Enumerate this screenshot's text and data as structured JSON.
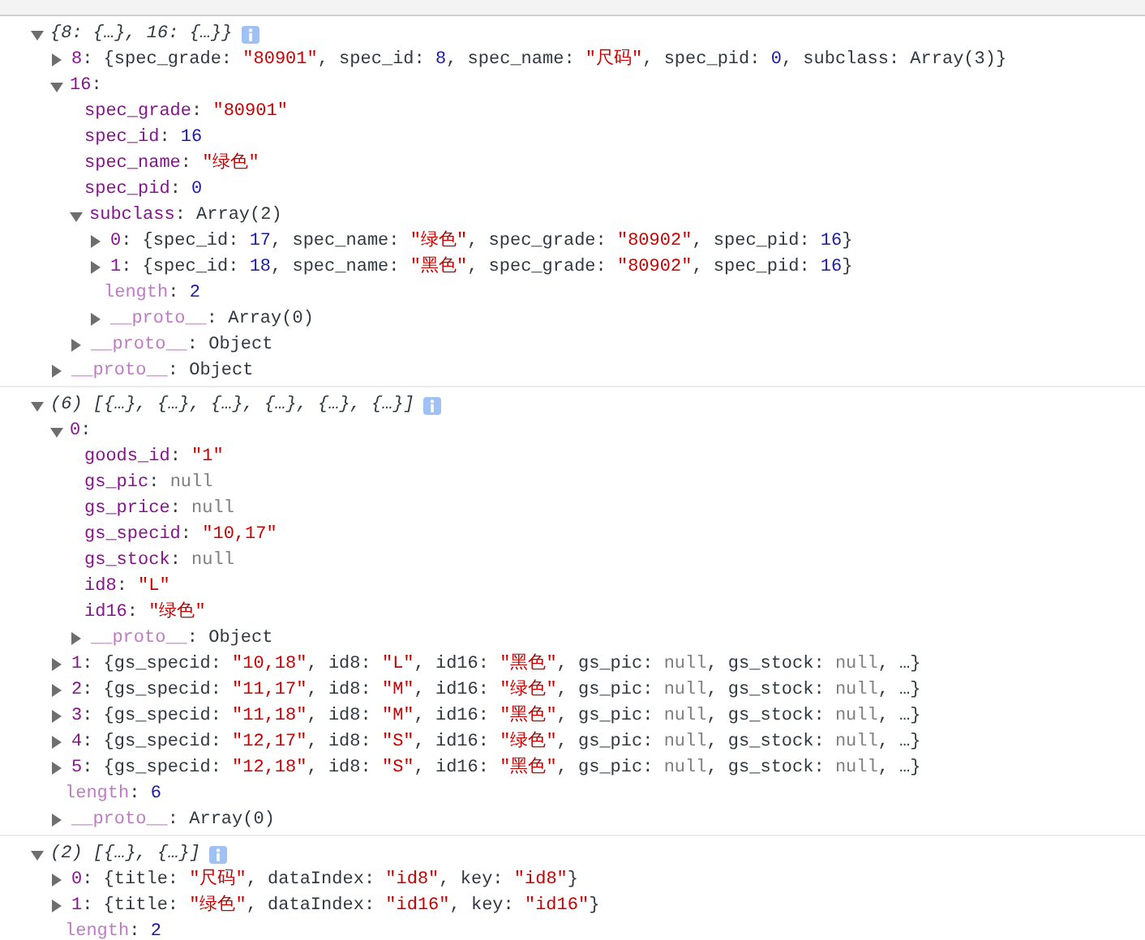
{
  "messages": [
    {
      "summary": [
        {
          "kind": "summary",
          "text": "{8: {…}, 16: {…}}"
        }
      ],
      "info_icon": true,
      "expanded": true,
      "children": [
        {
          "text": [
            {
              "kind": "index",
              "text": "8"
            },
            {
              "kind": "plain",
              "text": ": {spec_grade: "
            },
            {
              "kind": "str",
              "text": "\"80901\""
            },
            {
              "kind": "plain",
              "text": ", spec_id: "
            },
            {
              "kind": "num",
              "text": "8"
            },
            {
              "kind": "plain",
              "text": ", spec_name: "
            },
            {
              "kind": "str",
              "text": "\"尺码\""
            },
            {
              "kind": "plain",
              "text": ", spec_pid: "
            },
            {
              "kind": "num",
              "text": "0"
            },
            {
              "kind": "plain",
              "text": ", subclass: Array(3)}"
            }
          ],
          "expanded": false
        },
        {
          "text": [
            {
              "kind": "index",
              "text": "16"
            },
            {
              "kind": "plain",
              "text": ":"
            }
          ],
          "expanded": true,
          "children": [
            {
              "text": [
                {
                  "kind": "key",
                  "text": "spec_grade"
                },
                {
                  "kind": "plain",
                  "text": ": "
                },
                {
                  "kind": "str",
                  "text": "\"80901\""
                }
              ]
            },
            {
              "text": [
                {
                  "kind": "key",
                  "text": "spec_id"
                },
                {
                  "kind": "plain",
                  "text": ": "
                },
                {
                  "kind": "num",
                  "text": "16"
                }
              ]
            },
            {
              "text": [
                {
                  "kind": "key",
                  "text": "spec_name"
                },
                {
                  "kind": "plain",
                  "text": ": "
                },
                {
                  "kind": "str",
                  "text": "\"绿色\""
                }
              ]
            },
            {
              "text": [
                {
                  "kind": "key",
                  "text": "spec_pid"
                },
                {
                  "kind": "plain",
                  "text": ": "
                },
                {
                  "kind": "num",
                  "text": "0"
                }
              ]
            },
            {
              "text": [
                {
                  "kind": "key",
                  "text": "subclass"
                },
                {
                  "kind": "plain",
                  "text": ": Array(2)"
                }
              ],
              "expanded": true,
              "children": [
                {
                  "text": [
                    {
                      "kind": "index",
                      "text": "0"
                    },
                    {
                      "kind": "plain",
                      "text": ": {spec_id: "
                    },
                    {
                      "kind": "num",
                      "text": "17"
                    },
                    {
                      "kind": "plain",
                      "text": ", spec_name: "
                    },
                    {
                      "kind": "str",
                      "text": "\"绿色\""
                    },
                    {
                      "kind": "plain",
                      "text": ", spec_grade: "
                    },
                    {
                      "kind": "str",
                      "text": "\"80902\""
                    },
                    {
                      "kind": "plain",
                      "text": ", spec_pid: "
                    },
                    {
                      "kind": "num",
                      "text": "16"
                    },
                    {
                      "kind": "plain",
                      "text": "}"
                    }
                  ],
                  "expanded": false
                },
                {
                  "text": [
                    {
                      "kind": "index",
                      "text": "1"
                    },
                    {
                      "kind": "plain",
                      "text": ": {spec_id: "
                    },
                    {
                      "kind": "num",
                      "text": "18"
                    },
                    {
                      "kind": "plain",
                      "text": ", spec_name: "
                    },
                    {
                      "kind": "str",
                      "text": "\"黑色\""
                    },
                    {
                      "kind": "plain",
                      "text": ", spec_grade: "
                    },
                    {
                      "kind": "str",
                      "text": "\"80902\""
                    },
                    {
                      "kind": "plain",
                      "text": ", spec_pid: "
                    },
                    {
                      "kind": "num",
                      "text": "16"
                    },
                    {
                      "kind": "plain",
                      "text": "}"
                    }
                  ],
                  "expanded": false
                },
                {
                  "text": [
                    {
                      "kind": "meta",
                      "text": "length"
                    },
                    {
                      "kind": "plain",
                      "text": ": "
                    },
                    {
                      "kind": "num",
                      "text": "2"
                    }
                  ]
                },
                {
                  "text": [
                    {
                      "kind": "meta",
                      "text": "__proto__"
                    },
                    {
                      "kind": "plain",
                      "text": ": Array(0)"
                    }
                  ],
                  "expanded": false
                }
              ]
            },
            {
              "text": [
                {
                  "kind": "meta",
                  "text": "__proto__"
                },
                {
                  "kind": "plain",
                  "text": ": Object"
                }
              ],
              "expanded": false
            }
          ]
        },
        {
          "text": [
            {
              "kind": "meta",
              "text": "__proto__"
            },
            {
              "kind": "plain",
              "text": ": Object"
            }
          ],
          "expanded": false
        }
      ]
    },
    {
      "summary": [
        {
          "kind": "summary",
          "text": "(6) [{…}, {…}, {…}, {…}, {…}, {…}]"
        }
      ],
      "info_icon": true,
      "expanded": true,
      "children": [
        {
          "text": [
            {
              "kind": "index",
              "text": "0"
            },
            {
              "kind": "plain",
              "text": ":"
            }
          ],
          "expanded": true,
          "children": [
            {
              "text": [
                {
                  "kind": "key",
                  "text": "goods_id"
                },
                {
                  "kind": "plain",
                  "text": ": "
                },
                {
                  "kind": "str",
                  "text": "\"1\""
                }
              ]
            },
            {
              "text": [
                {
                  "kind": "key",
                  "text": "gs_pic"
                },
                {
                  "kind": "plain",
                  "text": ": "
                },
                {
                  "kind": "null",
                  "text": "null"
                }
              ]
            },
            {
              "text": [
                {
                  "kind": "key",
                  "text": "gs_price"
                },
                {
                  "kind": "plain",
                  "text": ": "
                },
                {
                  "kind": "null",
                  "text": "null"
                }
              ]
            },
            {
              "text": [
                {
                  "kind": "key",
                  "text": "gs_specid"
                },
                {
                  "kind": "plain",
                  "text": ": "
                },
                {
                  "kind": "str",
                  "text": "\"10,17\""
                }
              ]
            },
            {
              "text": [
                {
                  "kind": "key",
                  "text": "gs_stock"
                },
                {
                  "kind": "plain",
                  "text": ": "
                },
                {
                  "kind": "null",
                  "text": "null"
                }
              ]
            },
            {
              "text": [
                {
                  "kind": "key",
                  "text": "id8"
                },
                {
                  "kind": "plain",
                  "text": ": "
                },
                {
                  "kind": "str",
                  "text": "\"L\""
                }
              ]
            },
            {
              "text": [
                {
                  "kind": "key",
                  "text": "id16"
                },
                {
                  "kind": "plain",
                  "text": ": "
                },
                {
                  "kind": "str",
                  "text": "\"绿色\""
                }
              ]
            },
            {
              "text": [
                {
                  "kind": "meta",
                  "text": "__proto__"
                },
                {
                  "kind": "plain",
                  "text": ": Object"
                }
              ],
              "expanded": false
            }
          ]
        },
        {
          "text": [
            {
              "kind": "index",
              "text": "1"
            },
            {
              "kind": "plain",
              "text": ": {gs_specid: "
            },
            {
              "kind": "str",
              "text": "\"10,18\""
            },
            {
              "kind": "plain",
              "text": ", id8: "
            },
            {
              "kind": "str",
              "text": "\"L\""
            },
            {
              "kind": "plain",
              "text": ", id16: "
            },
            {
              "kind": "str",
              "text": "\"黑色\""
            },
            {
              "kind": "plain",
              "text": ", gs_pic: "
            },
            {
              "kind": "null",
              "text": "null"
            },
            {
              "kind": "plain",
              "text": ", gs_stock: "
            },
            {
              "kind": "null",
              "text": "null"
            },
            {
              "kind": "plain",
              "text": ", …}"
            }
          ],
          "expanded": false
        },
        {
          "text": [
            {
              "kind": "index",
              "text": "2"
            },
            {
              "kind": "plain",
              "text": ": {gs_specid: "
            },
            {
              "kind": "str",
              "text": "\"11,17\""
            },
            {
              "kind": "plain",
              "text": ", id8: "
            },
            {
              "kind": "str",
              "text": "\"M\""
            },
            {
              "kind": "plain",
              "text": ", id16: "
            },
            {
              "kind": "str",
              "text": "\"绿色\""
            },
            {
              "kind": "plain",
              "text": ", gs_pic: "
            },
            {
              "kind": "null",
              "text": "null"
            },
            {
              "kind": "plain",
              "text": ", gs_stock: "
            },
            {
              "kind": "null",
              "text": "null"
            },
            {
              "kind": "plain",
              "text": ", …}"
            }
          ],
          "expanded": false
        },
        {
          "text": [
            {
              "kind": "index",
              "text": "3"
            },
            {
              "kind": "plain",
              "text": ": {gs_specid: "
            },
            {
              "kind": "str",
              "text": "\"11,18\""
            },
            {
              "kind": "plain",
              "text": ", id8: "
            },
            {
              "kind": "str",
              "text": "\"M\""
            },
            {
              "kind": "plain",
              "text": ", id16: "
            },
            {
              "kind": "str",
              "text": "\"黑色\""
            },
            {
              "kind": "plain",
              "text": ", gs_pic: "
            },
            {
              "kind": "null",
              "text": "null"
            },
            {
              "kind": "plain",
              "text": ", gs_stock: "
            },
            {
              "kind": "null",
              "text": "null"
            },
            {
              "kind": "plain",
              "text": ", …}"
            }
          ],
          "expanded": false
        },
        {
          "text": [
            {
              "kind": "index",
              "text": "4"
            },
            {
              "kind": "plain",
              "text": ": {gs_specid: "
            },
            {
              "kind": "str",
              "text": "\"12,17\""
            },
            {
              "kind": "plain",
              "text": ", id8: "
            },
            {
              "kind": "str",
              "text": "\"S\""
            },
            {
              "kind": "plain",
              "text": ", id16: "
            },
            {
              "kind": "str",
              "text": "\"绿色\""
            },
            {
              "kind": "plain",
              "text": ", gs_pic: "
            },
            {
              "kind": "null",
              "text": "null"
            },
            {
              "kind": "plain",
              "text": ", gs_stock: "
            },
            {
              "kind": "null",
              "text": "null"
            },
            {
              "kind": "plain",
              "text": ", …}"
            }
          ],
          "expanded": false
        },
        {
          "text": [
            {
              "kind": "index",
              "text": "5"
            },
            {
              "kind": "plain",
              "text": ": {gs_specid: "
            },
            {
              "kind": "str",
              "text": "\"12,18\""
            },
            {
              "kind": "plain",
              "text": ", id8: "
            },
            {
              "kind": "str",
              "text": "\"S\""
            },
            {
              "kind": "plain",
              "text": ", id16: "
            },
            {
              "kind": "str",
              "text": "\"黑色\""
            },
            {
              "kind": "plain",
              "text": ", gs_pic: "
            },
            {
              "kind": "null",
              "text": "null"
            },
            {
              "kind": "plain",
              "text": ", gs_stock: "
            },
            {
              "kind": "null",
              "text": "null"
            },
            {
              "kind": "plain",
              "text": ", …}"
            }
          ],
          "expanded": false
        },
        {
          "text": [
            {
              "kind": "meta",
              "text": "length"
            },
            {
              "kind": "plain",
              "text": ": "
            },
            {
              "kind": "num",
              "text": "6"
            }
          ]
        },
        {
          "text": [
            {
              "kind": "meta",
              "text": "__proto__"
            },
            {
              "kind": "plain",
              "text": ": Array(0)"
            }
          ],
          "expanded": false
        }
      ]
    },
    {
      "summary": [
        {
          "kind": "summary",
          "text": "(2) [{…}, {…}]"
        }
      ],
      "info_icon": true,
      "expanded": true,
      "children": [
        {
          "text": [
            {
              "kind": "index",
              "text": "0"
            },
            {
              "kind": "plain",
              "text": ": {title: "
            },
            {
              "kind": "str",
              "text": "\"尺码\""
            },
            {
              "kind": "plain",
              "text": ", dataIndex: "
            },
            {
              "kind": "str",
              "text": "\"id8\""
            },
            {
              "kind": "plain",
              "text": ", key: "
            },
            {
              "kind": "str",
              "text": "\"id8\""
            },
            {
              "kind": "plain",
              "text": "}"
            }
          ],
          "expanded": false
        },
        {
          "text": [
            {
              "kind": "index",
              "text": "1"
            },
            {
              "kind": "plain",
              "text": ": {title: "
            },
            {
              "kind": "str",
              "text": "\"绿色\""
            },
            {
              "kind": "plain",
              "text": ", dataIndex: "
            },
            {
              "kind": "str",
              "text": "\"id16\""
            },
            {
              "kind": "plain",
              "text": ", key: "
            },
            {
              "kind": "str",
              "text": "\"id16\""
            },
            {
              "kind": "plain",
              "text": "}"
            }
          ],
          "expanded": false
        },
        {
          "text": [
            {
              "kind": "meta",
              "text": "length"
            },
            {
              "kind": "plain",
              "text": ": "
            },
            {
              "kind": "num",
              "text": "2"
            }
          ]
        }
      ]
    }
  ]
}
